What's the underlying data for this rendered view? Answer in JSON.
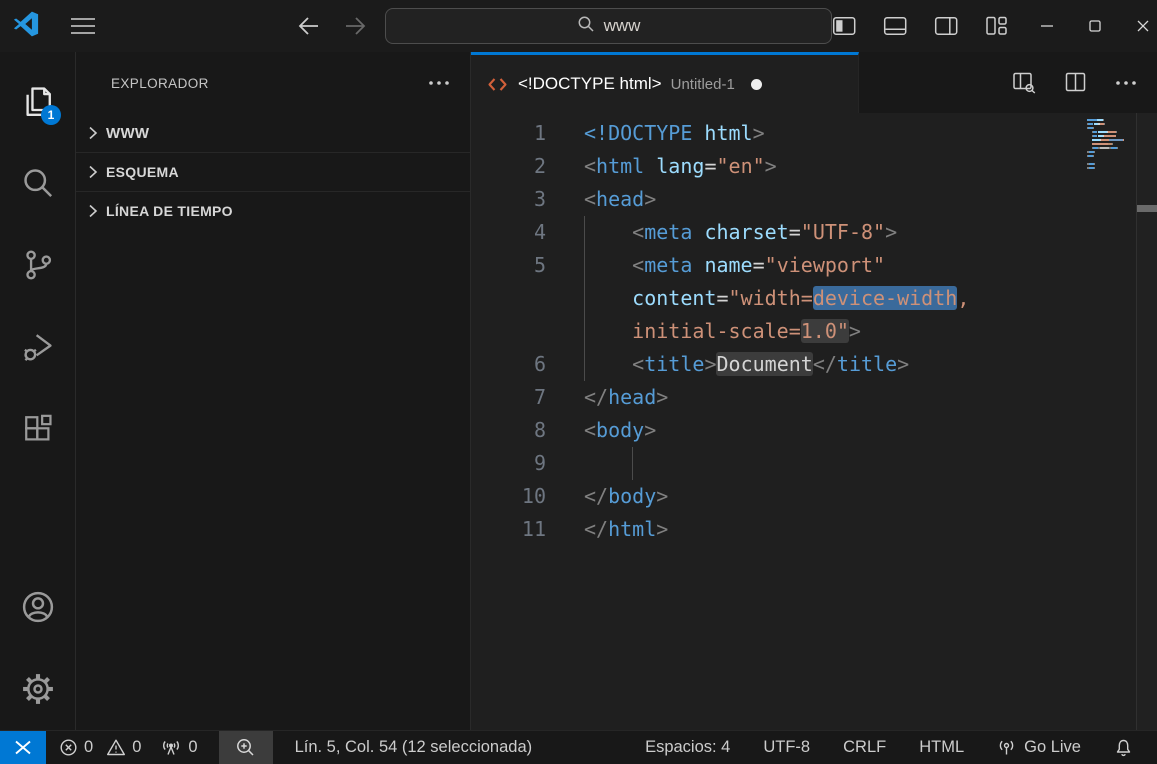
{
  "titlebar": {
    "search_value": "www"
  },
  "activity_bar": {
    "explorer_badge": "1"
  },
  "sidebar": {
    "title": "EXPLORADOR",
    "sections": [
      "WWW",
      "ESQUEMA",
      "LÍNEA DE TIEMPO"
    ]
  },
  "editor": {
    "tab": {
      "label": "<!DOCTYPE html>",
      "description": "Untitled-1",
      "modified": true
    },
    "syntax": {
      "p": {
        "color": "#808080"
      },
      "t": {
        "color": "#569cd6"
      },
      "n": {
        "color": "#9cdcfe"
      },
      "e": {
        "color": "#d4d4d4"
      },
      "s": {
        "color": "#ce9178"
      },
      "w": {
        "color": "#d4d4d4"
      },
      "sp": {
        "color": "transparent"
      },
      "sel": {
        "color": "#ce9178",
        "bg": "#3a6a9b",
        "minimap": "#6f97c0"
      },
      "ph": {
        "color": "#ce9178",
        "bg": "#3c3c3c",
        "minimap": "#b98a6d"
      },
      "phw": {
        "color": "#d4d4d4",
        "bg": "#3c3c3c",
        "minimap": "#bbbbbb"
      }
    },
    "lines": [
      {
        "num": "1",
        "tokens": [
          {
            "c": "t",
            "t": "<!DOCTYPE"
          },
          {
            "c": "n",
            "t": " html"
          },
          {
            "c": "p",
            "t": ">"
          }
        ]
      },
      {
        "num": "2",
        "tokens": [
          {
            "c": "p",
            "t": "<"
          },
          {
            "c": "t",
            "t": "html"
          },
          {
            "c": "sp",
            "t": " "
          },
          {
            "c": "n",
            "t": "lang"
          },
          {
            "c": "e",
            "t": "="
          },
          {
            "c": "s",
            "t": "\"en\""
          },
          {
            "c": "p",
            "t": ">"
          }
        ]
      },
      {
        "num": "3",
        "tokens": [
          {
            "c": "p",
            "t": "<"
          },
          {
            "c": "t",
            "t": "head"
          },
          {
            "c": "p",
            "t": ">"
          }
        ]
      },
      {
        "num": "4",
        "tokens": [
          {
            "c": "sp",
            "t": "    "
          },
          {
            "c": "p",
            "t": "<"
          },
          {
            "c": "t",
            "t": "meta"
          },
          {
            "c": "sp",
            "t": " "
          },
          {
            "c": "n",
            "t": "charset"
          },
          {
            "c": "e",
            "t": "="
          },
          {
            "c": "s",
            "t": "\"UTF-8\""
          },
          {
            "c": "p",
            "t": ">"
          }
        ]
      },
      {
        "num": "5",
        "tokens": [
          {
            "c": "sp",
            "t": "    "
          },
          {
            "c": "p",
            "t": "<"
          },
          {
            "c": "t",
            "t": "meta"
          },
          {
            "c": "sp",
            "t": " "
          },
          {
            "c": "n",
            "t": "name"
          },
          {
            "c": "e",
            "t": "="
          },
          {
            "c": "s",
            "t": "\"viewport\""
          }
        ]
      },
      {
        "num": "",
        "tokens": [
          {
            "c": "sp",
            "t": "    "
          },
          {
            "c": "n",
            "t": "content"
          },
          {
            "c": "e",
            "t": "="
          },
          {
            "c": "s",
            "t": "\"width="
          },
          {
            "c": "sel",
            "t": "device-width"
          },
          {
            "c": "s",
            "t": ","
          }
        ]
      },
      {
        "num": "",
        "tokens": [
          {
            "c": "sp",
            "t": "    "
          },
          {
            "c": "s",
            "t": "initial-scale="
          },
          {
            "c": "ph",
            "t": "1.0\""
          },
          {
            "c": "p",
            "t": ">"
          }
        ]
      },
      {
        "num": "6",
        "tokens": [
          {
            "c": "sp",
            "t": "    "
          },
          {
            "c": "p",
            "t": "<"
          },
          {
            "c": "t",
            "t": "title"
          },
          {
            "c": "p",
            "t": ">"
          },
          {
            "c": "phw",
            "t": "Document"
          },
          {
            "c": "p",
            "t": "</"
          },
          {
            "c": "t",
            "t": "title"
          },
          {
            "c": "p",
            "t": ">"
          }
        ]
      },
      {
        "num": "7",
        "tokens": [
          {
            "c": "p",
            "t": "</"
          },
          {
            "c": "t",
            "t": "head"
          },
          {
            "c": "p",
            "t": ">"
          }
        ]
      },
      {
        "num": "8",
        "tokens": [
          {
            "c": "p",
            "t": "<"
          },
          {
            "c": "t",
            "t": "body"
          },
          {
            "c": "p",
            "t": ">"
          }
        ]
      },
      {
        "num": "9",
        "tokens": []
      },
      {
        "num": "10",
        "tokens": [
          {
            "c": "p",
            "t": "</"
          },
          {
            "c": "t",
            "t": "body"
          },
          {
            "c": "p",
            "t": ">"
          }
        ]
      },
      {
        "num": "11",
        "tokens": [
          {
            "c": "p",
            "t": "</"
          },
          {
            "c": "t",
            "t": "html"
          },
          {
            "c": "p",
            "t": ">"
          }
        ]
      }
    ]
  },
  "status_bar": {
    "errors": "0",
    "warnings": "0",
    "ports": "0",
    "cursor": "Lín. 5, Col. 54 (12 seleccionada)",
    "indentation": "Espacios: 4",
    "encoding": "UTF-8",
    "eol": "CRLF",
    "language": "HTML",
    "go_live": "Go Live"
  },
  "colors": {
    "accent": "#0078d4",
    "editor_bg": "#1f1f1f",
    "chrome_bg": "#181818",
    "selection_bg": "#3a6a9b",
    "snippet_placeholder_bg": "#3c3c3c",
    "tab_active_border": "#0078d4"
  }
}
